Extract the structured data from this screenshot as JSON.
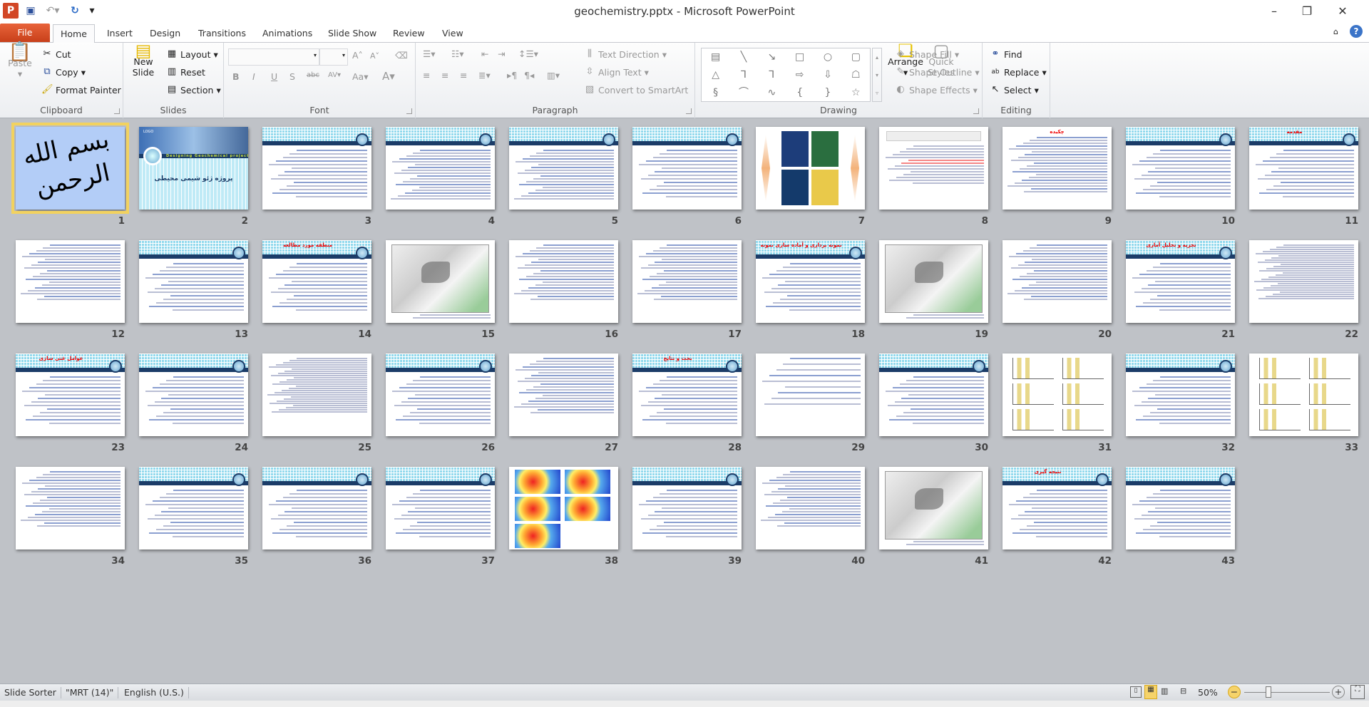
{
  "window": {
    "title": "geochemistry.pptx - Microsoft PowerPoint",
    "app_icon": "P",
    "controls": [
      "minimize",
      "restore",
      "close"
    ]
  },
  "qat": {
    "save": "save-icon",
    "undo": "undo-icon",
    "redo": "redo-icon",
    "customize": "▾"
  },
  "tabs": [
    {
      "label": "File"
    },
    {
      "label": "Home",
      "active": true
    },
    {
      "label": "Insert"
    },
    {
      "label": "Design"
    },
    {
      "label": "Transitions"
    },
    {
      "label": "Animations"
    },
    {
      "label": "Slide Show"
    },
    {
      "label": "Review"
    },
    {
      "label": "View"
    }
  ],
  "ribbon": {
    "clipboard": {
      "label": "Clipboard",
      "paste": "Paste",
      "cut": "Cut",
      "copy": "Copy",
      "format_painter": "Format Painter"
    },
    "slides": {
      "label": "Slides",
      "new_slide": "New\nSlide",
      "layout": "Layout",
      "reset": "Reset",
      "section": "Section"
    },
    "font": {
      "label": "Font",
      "font_name": "",
      "font_size": ""
    },
    "paragraph": {
      "label": "Paragraph",
      "text_direction": "Text Direction",
      "align_text": "Align Text",
      "convert_smartart": "Convert to SmartArt"
    },
    "drawing": {
      "label": "Drawing",
      "arrange": "Arrange",
      "quick_styles": "Quick\nStyles",
      "shape_fill": "Shape Fill",
      "shape_outline": "Shape Outline",
      "shape_effects": "Shape Effects",
      "shapes": [
        "▤",
        "╲",
        "↘",
        "□",
        "○",
        "▢",
        "△",
        "⅂",
        "⅂",
        "⇨",
        "⇩",
        "☖",
        "§",
        "⌒",
        "∿",
        "{",
        "}",
        "☆"
      ]
    },
    "editing": {
      "label": "Editing",
      "find": "Find",
      "replace": "Replace",
      "select": "Select"
    }
  },
  "slides": [
    {
      "n": "1",
      "type": "calligraphy",
      "selected": true
    },
    {
      "n": "2",
      "type": "cover",
      "subtitle": "Designing Geochemical projects",
      "title": "پروژه ژئو شیمی محیطی",
      "logo": "LOGO"
    },
    {
      "n": "3",
      "type": "header"
    },
    {
      "n": "4",
      "type": "header-dense"
    },
    {
      "n": "5",
      "type": "header-dense"
    },
    {
      "n": "6",
      "type": "header"
    },
    {
      "n": "7",
      "type": "images"
    },
    {
      "n": "8",
      "type": "paper"
    },
    {
      "n": "9",
      "type": "plain",
      "title": "چکیده"
    },
    {
      "n": "10",
      "type": "header"
    },
    {
      "n": "11",
      "type": "header",
      "title": "مقدمه"
    },
    {
      "n": "12",
      "type": "plain"
    },
    {
      "n": "13",
      "type": "header"
    },
    {
      "n": "14",
      "type": "header",
      "title": "منطقه مورد مطالعه"
    },
    {
      "n": "15",
      "type": "map"
    },
    {
      "n": "16",
      "type": "plain"
    },
    {
      "n": "17",
      "type": "plain"
    },
    {
      "n": "18",
      "type": "header",
      "title": "نمونه برداری و آماده سازی نمونه"
    },
    {
      "n": "19",
      "type": "map"
    },
    {
      "n": "20",
      "type": "plain"
    },
    {
      "n": "21",
      "type": "header",
      "title": "تجزیه و تحلیل آماری"
    },
    {
      "n": "22",
      "type": "table"
    },
    {
      "n": "23",
      "type": "header",
      "title": "عوامل غنی سازی"
    },
    {
      "n": "24",
      "type": "header"
    },
    {
      "n": "25",
      "type": "table"
    },
    {
      "n": "26",
      "type": "header"
    },
    {
      "n": "27",
      "type": "plain"
    },
    {
      "n": "28",
      "type": "header",
      "title": "بحث و نتایج"
    },
    {
      "n": "29",
      "type": "plain-sparse"
    },
    {
      "n": "30",
      "type": "header"
    },
    {
      "n": "31",
      "type": "charts"
    },
    {
      "n": "32",
      "type": "header"
    },
    {
      "n": "33",
      "type": "charts"
    },
    {
      "n": "34",
      "type": "plain"
    },
    {
      "n": "35",
      "type": "header"
    },
    {
      "n": "36",
      "type": "header"
    },
    {
      "n": "37",
      "type": "header"
    },
    {
      "n": "38",
      "type": "heatmaps"
    },
    {
      "n": "39",
      "type": "header"
    },
    {
      "n": "40",
      "type": "plain"
    },
    {
      "n": "41",
      "type": "map"
    },
    {
      "n": "42",
      "type": "header",
      "title": "نتیجه گیری"
    },
    {
      "n": "43",
      "type": "header"
    }
  ],
  "statusbar": {
    "view": "Slide Sorter",
    "theme": "\"MRT (14)\"",
    "language": "English (U.S.)",
    "zoom": "50%",
    "zoom_percent": 50
  }
}
